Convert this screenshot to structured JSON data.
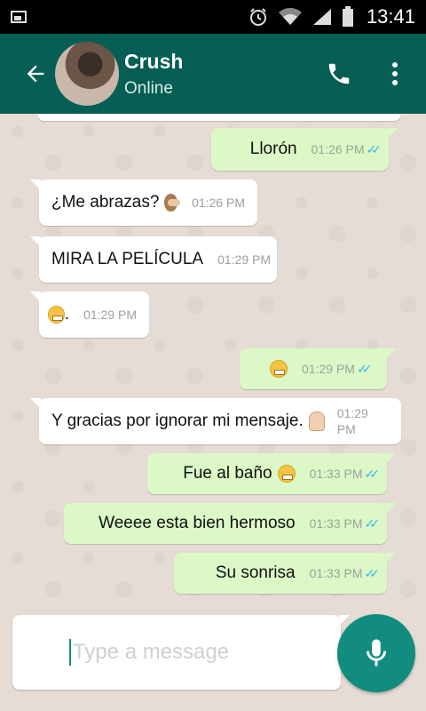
{
  "status_bar": {
    "time": "13:41",
    "icons": [
      "image-icon",
      "alarm-icon",
      "wifi-icon",
      "signal-icon",
      "battery-icon"
    ]
  },
  "header": {
    "contact_name": "Crush",
    "contact_status": "Online",
    "icons": [
      "back-arrow-icon",
      "avatar",
      "phone-icon",
      "more-vert-icon"
    ],
    "color": "#075e54"
  },
  "messages": [
    {
      "direction": "out",
      "text": "Llorón",
      "time": "01:26 PM",
      "read": true
    },
    {
      "direction": "in",
      "text": "¿Me abrazas?",
      "emoji": "see-no-evil-monkey-icon",
      "time": "01:26 PM"
    },
    {
      "direction": "in",
      "text": "MIRA LA PELÍCULA",
      "time": "01:29 PM"
    },
    {
      "direction": "in",
      "text": ".",
      "emoji": "grimacing-face-icon",
      "time": "01:29 PM"
    },
    {
      "direction": "out",
      "text": "",
      "emoji": "grimacing-face-icon",
      "time": "01:29 PM",
      "read": true
    },
    {
      "direction": "in",
      "text": "Y gracias por ignorar mi mensaje.",
      "emoji": "ok-hand-icon",
      "time_line1": "01:29",
      "time_line2": "PM"
    },
    {
      "direction": "out",
      "text": "Fue al baño",
      "emoji": "grimacing-face-icon",
      "time": "01:33 PM",
      "read": true
    },
    {
      "direction": "out",
      "text": "Weeee esta bien hermoso",
      "time": "01:33 PM",
      "read": true
    },
    {
      "direction": "out",
      "text": "Su sonrisa",
      "time": "01:33 PM",
      "read": true
    }
  ],
  "composer": {
    "placeholder": "Type a message",
    "value": "",
    "mic_icon": "microphone-icon",
    "button_color": "#128c7e"
  },
  "colors": {
    "incoming_bubble": "#ffffff",
    "outgoing_bubble": "#dcf8c6",
    "chat_background": "#e5ddd5",
    "read_ticks": "#34b7f1"
  }
}
